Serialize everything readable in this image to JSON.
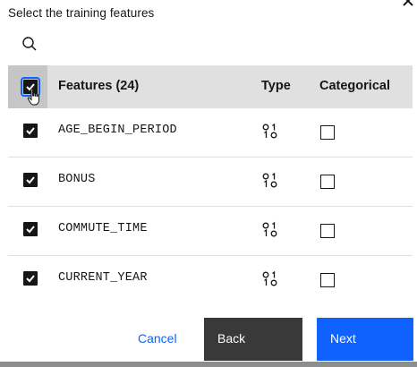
{
  "dialog": {
    "title": "Select the training features",
    "close_icon": "close-icon"
  },
  "search": {
    "placeholder": "",
    "value": "",
    "icon": "search-icon"
  },
  "table": {
    "columns": {
      "features": "Features (24)",
      "type": "Type",
      "categorical": "Categorical"
    },
    "select_all_checked": true,
    "rows": [
      {
        "name": "AGE_BEGIN_PERIOD",
        "selected": true,
        "type_icon": "numeric-type-icon",
        "categorical": false
      },
      {
        "name": "BONUS",
        "selected": true,
        "type_icon": "numeric-type-icon",
        "categorical": false
      },
      {
        "name": "COMMUTE_TIME",
        "selected": true,
        "type_icon": "numeric-type-icon",
        "categorical": false
      },
      {
        "name": "CURRENT_YEAR",
        "selected": true,
        "type_icon": "numeric-type-icon",
        "categorical": false
      }
    ]
  },
  "footer": {
    "cancel_label": "Cancel",
    "back_label": "Back",
    "next_label": "Next"
  },
  "colors": {
    "accent": "#0f62fe",
    "header_bg": "#e0e0e0",
    "back_bg": "#393939"
  }
}
